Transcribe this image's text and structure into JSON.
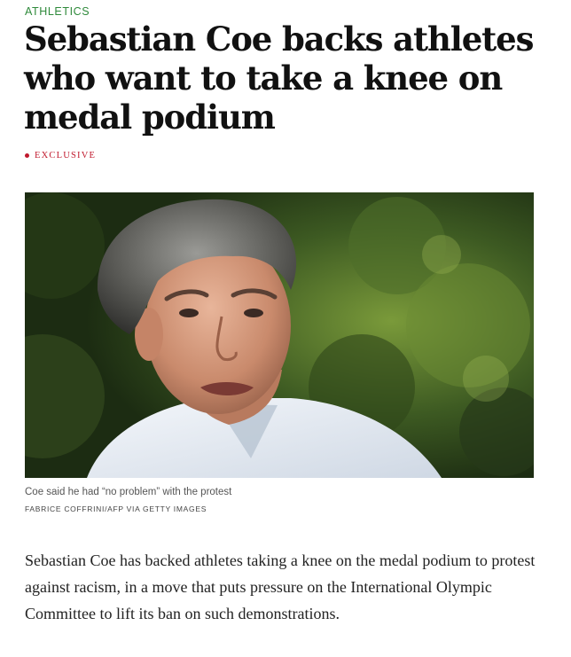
{
  "theme": {
    "section_color": "#2f8a3b",
    "exclusive_color": "#c0192d"
  },
  "article": {
    "section": "Athletics",
    "headline": "Sebastian Coe backs athletes who want to take a knee on medal podium",
    "label": "Exclusive",
    "image": {
      "caption": "Coe said he had “no problem” with the protest",
      "credit": "Fabrice Coffrini/AFP via Getty Images"
    },
    "body": "Sebastian Coe has backed athletes taking a knee on the medal podium to protest against racism, in a move that puts pressure on the International Olympic Committee to lift its ban on such demonstrations."
  }
}
